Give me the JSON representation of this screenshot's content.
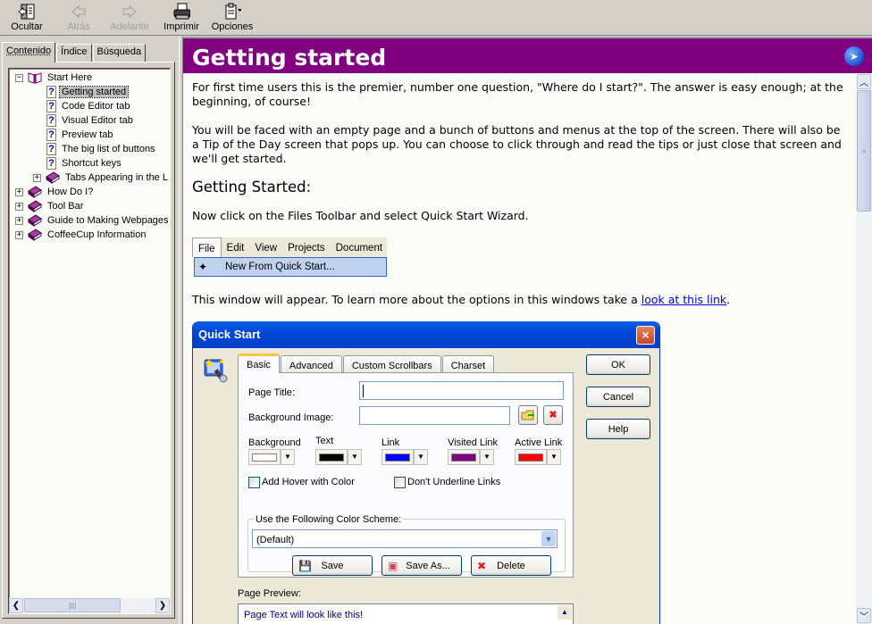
{
  "toolbar": {
    "hide": "Ocultar",
    "back": "Atrás",
    "forward": "Adelante",
    "print": "Imprimir",
    "options": "Opciones"
  },
  "nav_tabs": {
    "contents": "Contenido",
    "index": "Índice",
    "search": "Búsqueda"
  },
  "tree": {
    "root": "Start Here",
    "children": [
      "Getting started",
      "Code Editor tab",
      "Visual Editor tab",
      "Preview tab",
      "The big list of buttons",
      "Shortcut keys"
    ],
    "subbook": "Tabs Appearing in the L",
    "books": [
      "How Do I?",
      "Tool Bar",
      "Guide to Making Webpages",
      "CoffeeCup Information"
    ],
    "selected": "Getting started"
  },
  "page": {
    "title": "Getting started",
    "para1": "For first time users this is the premier, number one question, \"Where do I start?\". The answer is easy enough; at the beginning, of course!",
    "para2": "You will be faced with an empty page and a bunch of buttons and menus at the top of the screen.  There will also be a Tip of the Day screen that pops up. You can choose to click through and read the tips or just close that screen and we'll get started.",
    "heading": "Getting Started:",
    "para3": "Now click on the Files Toolbar and select Quick Start Wizard.",
    "para4_prefix": "This window will appear. To learn more about the options in this windows take a ",
    "para4_link": "look at this link",
    "para4_suffix": "."
  },
  "menu_image": {
    "menus": [
      "File",
      "Edit",
      "View",
      "Projects",
      "Document"
    ],
    "item": "New From Quick Start..."
  },
  "dialog": {
    "title": "Quick Start",
    "tabs": [
      "Basic",
      "Advanced",
      "Custom Scrollbars",
      "Charset"
    ],
    "active_tab": "Basic",
    "page_title_label": "Page Title:",
    "page_title_value": "",
    "bg_image_label": "Background Image:",
    "bg_image_value": "",
    "colors": [
      {
        "label": "Background",
        "value": "#ffffff"
      },
      {
        "label": "Text",
        "value": "#000000"
      },
      {
        "label": "Link",
        "value": "#0000ff"
      },
      {
        "label": "Visited Link",
        "value": "#800080"
      },
      {
        "label": "Active Link",
        "value": "#ff0000"
      }
    ],
    "hover_checkbox": "Add Hover with Color",
    "underline_checkbox": "Don't Underline Links",
    "scheme_label": "Use the Following Color Scheme:",
    "scheme_value": "(Default)",
    "save": "Save",
    "save_as": "Save As...",
    "delete": "Delete",
    "ok": "OK",
    "cancel": "Cancel",
    "help": "Help",
    "preview_label": "Page Preview:",
    "preview_text": "Page Text will look like this!"
  }
}
